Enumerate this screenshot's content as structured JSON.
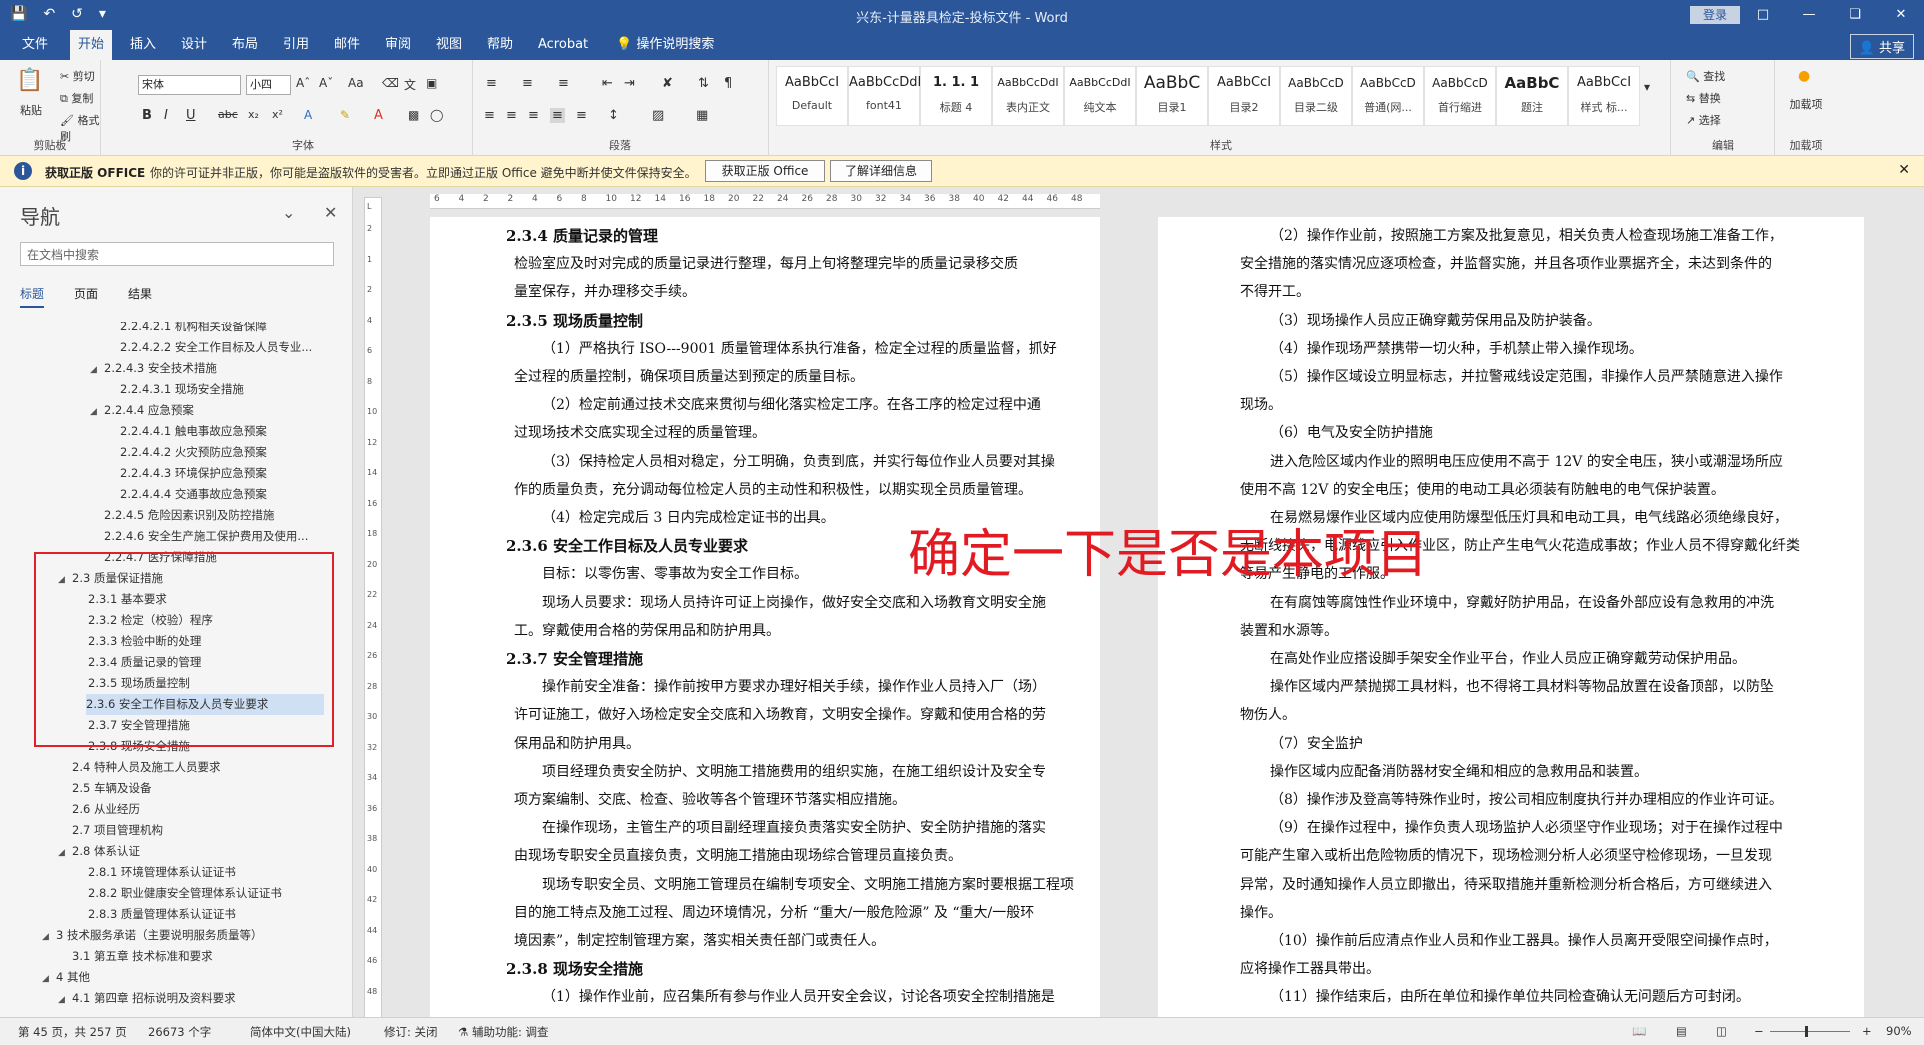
{
  "titlebar": {
    "title": "兴东-计量器具检定-投标文件 - Word",
    "login": "登录",
    "quick_access": [
      "save-icon",
      "undo-icon",
      "redo-icon",
      "customize-icon"
    ]
  },
  "menu": {
    "tabs": [
      "文件",
      "开始",
      "插入",
      "设计",
      "布局",
      "引用",
      "邮件",
      "审阅",
      "视图",
      "帮助",
      "Acrobat",
      "操作说明搜索"
    ],
    "share": "共享"
  },
  "ribbon": {
    "clipboard": {
      "paste": "粘贴",
      "cut": "剪切",
      "copy": "复制",
      "format_painter": "格式刷",
      "label": "剪贴板"
    },
    "font": {
      "name": "宋体",
      "size": "小四",
      "label": "字体"
    },
    "paragraph": {
      "label": "段落"
    },
    "styles": {
      "label": "样式",
      "items": [
        {
          "preview": "AaBbCcI",
          "name": "Default"
        },
        {
          "preview": "AaBbCcDdI",
          "name": "font41"
        },
        {
          "preview": "1. 1. 1",
          "name": "标题 4"
        },
        {
          "preview": "AaBbCcDdI",
          "name": "表内正文"
        },
        {
          "preview": "AaBbCcDdI",
          "name": "纯文本"
        },
        {
          "preview": "AaBbC",
          "name": "目录1"
        },
        {
          "preview": "AaBbCcI",
          "name": "目录2"
        },
        {
          "preview": "AaBbCcD",
          "name": "目录二级"
        },
        {
          "preview": "AaBbCcD",
          "name": "普通(网..."
        },
        {
          "preview": "AaBbCcD",
          "name": "首行缩进"
        },
        {
          "preview": "AaBbC",
          "name": "题注"
        },
        {
          "preview": "AaBbCcI",
          "name": "样式 标..."
        }
      ]
    },
    "editing": {
      "find": "查找",
      "replace": "替换",
      "select": "选择",
      "label": "编辑"
    },
    "addins": {
      "load": "加载项",
      "label": "加载项"
    }
  },
  "warning": {
    "title": "获取正版 OFFICE",
    "text": "你的许可证并非正版，你可能是盗版软件的受害者。立即通过正版 Office 避免中断并使文件保持安全。",
    "btn1": "获取正版 Office",
    "btn2": "了解详细信息"
  },
  "nav": {
    "title": "导航",
    "search_placeholder": "在文档中搜索",
    "tabs": [
      "标题",
      "页面",
      "结果"
    ],
    "items": [
      {
        "text": "2.2.4.2.1 机构相关设备保障"
      },
      {
        "text": "2.2.4.2.2 安全工作目标及人员专业..."
      },
      {
        "text": "2.2.4.3 安全技术措施"
      },
      {
        "text": "2.2.4.3.1 现场安全措施"
      },
      {
        "text": "2.2.4.4 应急预案"
      },
      {
        "text": "2.2.4.4.1 触电事故应急预案"
      },
      {
        "text": "2.2.4.4.2 火灾预防应急预案"
      },
      {
        "text": "2.2.4.4.3 环境保护应急预案"
      },
      {
        "text": "2.2.4.4.4 交通事故应急预案"
      },
      {
        "text": "2.2.4.5 危险因素识别及防控措施"
      },
      {
        "text": "2.2.4.6 安全生产施工保护费用及使用..."
      },
      {
        "text": "2.2.4.7 医疗保障措施"
      },
      {
        "text": "2.3 质量保证措施"
      },
      {
        "text": "2.3.1 基本要求"
      },
      {
        "text": "2.3.2 检定（校验）程序"
      },
      {
        "text": "2.3.3 检验中断的处理"
      },
      {
        "text": "2.3.4 质量记录的管理"
      },
      {
        "text": "2.3.5 现场质量控制"
      },
      {
        "text": "2.3.6 安全工作目标及人员专业要求"
      },
      {
        "text": "2.3.7 安全管理措施"
      },
      {
        "text": "2.3.8 现场安全措施"
      },
      {
        "text": "2.4 特种人员及施工人员要求"
      },
      {
        "text": "2.5 车辆及设备"
      },
      {
        "text": "2.6 从业经历"
      },
      {
        "text": "2.7 项目管理机构"
      },
      {
        "text": "2.8 体系认证"
      },
      {
        "text": "2.8.1 环境管理体系认证证书"
      },
      {
        "text": "2.8.2 职业健康安全管理体系认证证书"
      },
      {
        "text": "2.8.3 质量管理体系认证证书"
      },
      {
        "text": "3 技术服务承诺（主要说明服务质量等）"
      },
      {
        "text": "3.1 第五章  技术标准和要求"
      },
      {
        "text": "4 其他"
      },
      {
        "text": "4.1 第四章  招标说明及资料要求"
      }
    ]
  },
  "page_left": [
    "2.3.4 质量记录的管理",
    "检验室应及时对完成的质量记录进行整理，每月上旬将整理完毕的质量记录移交质",
    "量室保存，并办理移交手续。",
    "2.3.5 现场质量控制",
    "（1）严格执行 ISO---9001 质量管理体系执行准备，检定全过程的质量监督，抓好",
    "全过程的质量控制，确保项目质量达到预定的质量目标。",
    "（2）检定前通过技术交底来贯彻与细化落实检定工序。在各工序的检定过程中通",
    "过现场技术交底实现全过程的质量管理。",
    "（3）保持检定人员相对稳定，分工明确，负责到底，并实行每位作业人员要对其操",
    "作的质量负责，充分调动每位检定人员的主动性和积极性，以期实现全员质量管理。",
    "（4）检定完成后 3 日内完成检定证书的出具。",
    "2.3.6 安全工作目标及人员专业要求",
    "目标：以零伤害、零事故为安全工作目标。",
    "现场人员要求：现场人员持许可证上岗操作，做好安全交底和入场教育文明安全施",
    "工。穿戴使用合格的劳保用品和防护用具。",
    "2.3.7 安全管理措施",
    "操作前安全准备：操作前按甲方要求办理好相关手续，操作作业人员持入厂（场）",
    "许可证施工，做好入场检定安全交底和入场教育，文明安全操作。穿戴和使用合格的劳",
    "保用品和防护用具。",
    "项目经理负责安全防护、文明施工措施费用的组织实施，在施工组织设计及安全专",
    "项方案编制、交底、检查、验收等各个管理环节落实相应措施。",
    "在操作现场，主管生产的项目副经理直接负责落实安全防护、安全防护措施的落实",
    "由现场专职安全员直接负责，文明施工措施由现场综合管理员直接负责。",
    "现场专职安全员、文明施工管理员在编制专项安全、文明施工措施方案时要根据工程项",
    "目的施工特点及施工过程、周边环境情况，分析 “重大/一般危险源” 及 “重大/一般环",
    "境因素”，制定控制管理方案，落实相关责任部门或责任人。",
    "2.3.8 现场安全措施",
    "（1）操作作业前，应召集所有参与作业人员开安全会议，讨论各项安全控制措施是"
  ],
  "page_right": [
    "（2）操作作业前，按照施工方案及批复意见，相关负责人检查现场施工准备工作，",
    "安全措施的落实情况应逐项检查，并监督实施，并且各项作业票据齐全，未达到条件的",
    "不得开工。",
    "（3）现场操作人员应正确穿戴劳保用品及防护装备。",
    "（4）操作现场严禁携带一切火种，手机禁止带入操作现场。",
    "（5）操作区域设立明显标志，并拉警戒线设定范围，非操作人员严禁随意进入操作",
    "现场。",
    "（6）电气及安全防护措施",
    "进入危险区域内作业的照明电压应使用不高于 12V 的安全电压，狭小或潮湿场所应",
    "使用不高 12V 的安全电压；使用的电动工具必须装有防触电的电气保护装置。",
    "在易燃易爆作业区域内应使用防爆型低压灯具和电动工具，电气线路必须绝缘良好，",
    "无断线接头，电源线应引入作业区，防止产生电气火花造成事故；作业人员不得穿戴化纤类",
    "等易产生静电的工作服。",
    "在有腐蚀等腐蚀性作业环境中，穿戴好防护用品，在设备外部应设有急救用的冲洗",
    "装置和水源等。",
    "在高处作业应搭设脚手架安全作业平台，作业人员应正确穿戴劳动保护用品。",
    "操作区域内严禁抛掷工具材料，也不得将工具材料等物品放置在设备顶部，以防坠",
    "物伤人。",
    "（7）安全监护",
    "操作区域内应配备消防器材安全绳和相应的急救用品和装置。",
    "（8）操作涉及登高等特殊作业时，按公司相应制度执行并办理相应的作业许可证。",
    "（9）在操作过程中，操作负责人现场监护人必须坚守作业现场；对于在操作过程中",
    "可能产生窜入或析出危险物质的情况下，现场检测分析人必须坚守检修现场，一旦发现",
    "异常，及时通知操作人员立即撤出，待采取措施并重新检测分析合格后，方可继续进入",
    "操作。",
    "（10）操作前后应清点作业人员和作业工器具。操作人员离开受限空间操作点时，",
    "应将操作工器具带出。",
    "（11）操作结束后，由所在单位和操作单位共同检查确认无问题后方可封闭。"
  ],
  "overlay_text": "确定一下是否是本项目",
  "ruler_h": [
    "6",
    "4",
    "2",
    "2",
    "4",
    "6",
    "8",
    "10",
    "12",
    "14",
    "16",
    "18",
    "20",
    "22",
    "24",
    "26",
    "28",
    "30",
    "32",
    "34",
    "36",
    "38",
    "40",
    "42",
    "44",
    "46",
    "48"
  ],
  "ruler_v": [
    "2",
    "1",
    "2",
    "4",
    "6",
    "8",
    "10",
    "12",
    "14",
    "16",
    "18",
    "20",
    "22",
    "24",
    "26",
    "28",
    "30",
    "32",
    "34",
    "36",
    "38",
    "40",
    "42",
    "44",
    "46",
    "48"
  ],
  "status": {
    "page": "第 45 页，共 257 页",
    "words": "26673 个字",
    "lang": "简体中文(中国大陆)",
    "track": "修订: 关闭",
    "access": "辅助功能: 调查",
    "zoom": "90%"
  }
}
